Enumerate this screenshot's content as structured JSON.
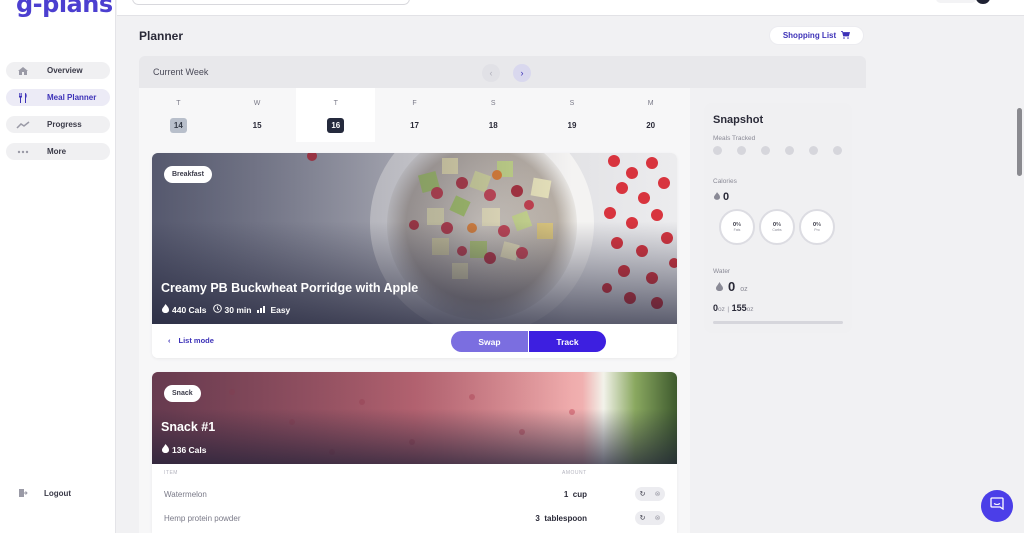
{
  "brand": {
    "logo_text": "g-plans",
    "accent": "#4c3fd0"
  },
  "sidebar": {
    "items": [
      {
        "label": "Overview",
        "icon": "home-icon"
      },
      {
        "label": "Meal Planner",
        "icon": "cutlery-icon"
      },
      {
        "label": "Progress",
        "icon": "trend-icon"
      },
      {
        "label": "More",
        "icon": "more-dots-icon"
      }
    ],
    "logout_label": "Logout"
  },
  "header": {
    "title": "Planner",
    "shopping_list_label": "Shopping List"
  },
  "week": {
    "label": "Current Week",
    "days": [
      {
        "letter": "T",
        "num": "14"
      },
      {
        "letter": "W",
        "num": "15"
      },
      {
        "letter": "T",
        "num": "16"
      },
      {
        "letter": "F",
        "num": "17"
      },
      {
        "letter": "S",
        "num": "18"
      },
      {
        "letter": "S",
        "num": "19"
      },
      {
        "letter": "M",
        "num": "20"
      }
    ]
  },
  "meals": [
    {
      "badge": "Breakfast",
      "title": "Creamy PB Buckwheat Porridge with Apple",
      "calories": "440 Cals",
      "time": "30 min",
      "difficulty": "Easy",
      "list_mode_label": "List mode",
      "swap_label": "Swap",
      "track_label": "Track"
    },
    {
      "badge": "Snack",
      "title": "Snack #1",
      "calories": "136 Cals",
      "columns": {
        "item": "ITEM",
        "amount": "AMOUNT"
      },
      "ingredients": [
        {
          "name": "Watermelon",
          "qty": "1",
          "unit": "cup"
        },
        {
          "name": "Hemp protein powder",
          "qty": "3",
          "unit": "tablespoon"
        }
      ]
    }
  ],
  "snapshot": {
    "title": "Snapshot",
    "meals_tracked_label": "Meals Tracked",
    "calories_label": "Calories",
    "calories_value": "0",
    "macros": [
      {
        "value": "0",
        "unit": "%",
        "label": "Fats"
      },
      {
        "value": "0",
        "unit": "%",
        "label": "Carbs"
      },
      {
        "value": "0",
        "unit": "%",
        "label": "Pro"
      }
    ],
    "water_label": "Water",
    "water_value": "0",
    "water_unit": "oz",
    "water_consumed": "0",
    "water_goal": "155",
    "water_sep": "|"
  }
}
